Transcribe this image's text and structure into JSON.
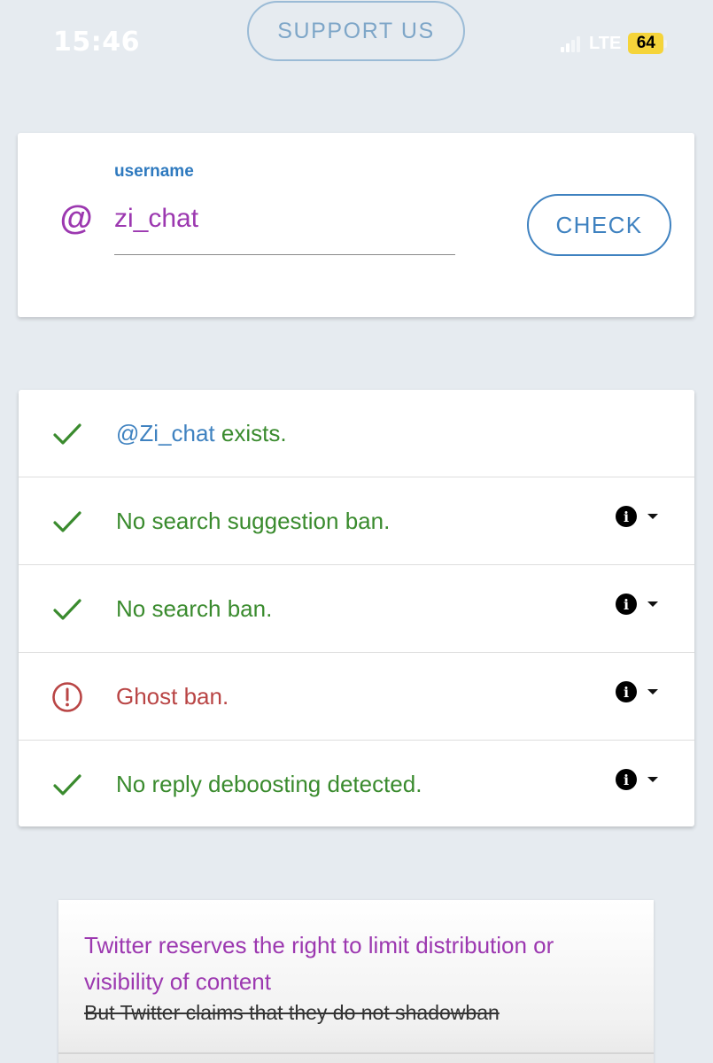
{
  "status_bar": {
    "time": "15:46",
    "network": "LTE",
    "battery": "64",
    "signal_icon": "signal-bars-icon"
  },
  "header": {
    "support_label": "SUPPORT US"
  },
  "search": {
    "icon": "at-sign-icon",
    "field_label": "username",
    "value": "zi_chat",
    "button_label": "CHECK"
  },
  "results": {
    "rows": [
      {
        "status": "ok",
        "handle": "@Zi_chat",
        "text": " exists.",
        "has_info": false
      },
      {
        "status": "ok",
        "text": "No search suggestion ban.",
        "has_info": true
      },
      {
        "status": "ok",
        "text": "No search ban.",
        "has_info": true
      },
      {
        "status": "warn",
        "text": "Ghost ban.",
        "has_info": true
      },
      {
        "status": "ok",
        "text": "No reply deboosting detected.",
        "has_info": true
      }
    ]
  },
  "note": {
    "headline": "Twitter reserves the right to limit distribution or visibility of content",
    "struck_text": "But Twitter claims that they do not shadowban"
  },
  "colors": {
    "background": "#e6ebf0",
    "accent_blue": "#3f82c0",
    "purple": "#9c38b0",
    "ok_green": "#3a8b2e",
    "warn_red": "#b94545",
    "battery_yellow": "#f5d43a"
  }
}
